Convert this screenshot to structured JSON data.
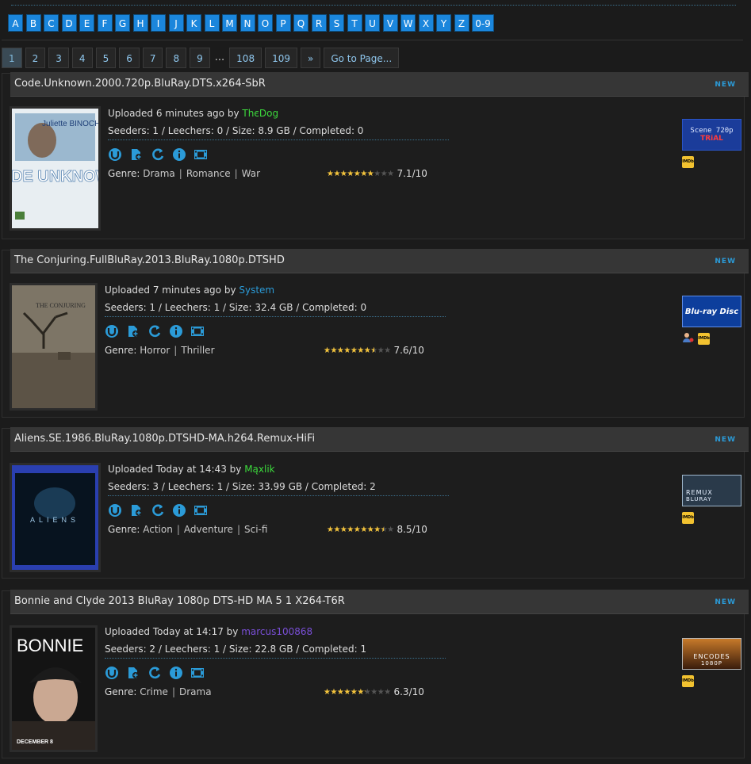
{
  "alphabet": [
    "A",
    "B",
    "C",
    "D",
    "E",
    "F",
    "G",
    "H",
    "I",
    "J",
    "K",
    "L",
    "M",
    "N",
    "O",
    "P",
    "Q",
    "R",
    "S",
    "T",
    "U",
    "V",
    "W",
    "X",
    "Y",
    "Z",
    "0-9"
  ],
  "pager": {
    "pages": [
      "1",
      "2",
      "3",
      "4",
      "5",
      "6",
      "7",
      "8",
      "9"
    ],
    "dots": "...",
    "last_pages": [
      "108",
      "109"
    ],
    "next": "»",
    "goto": "Go to Page..."
  },
  "torrents": [
    {
      "title": "Code.Unknown.2000.720p.BluRay.DTS.x264-SbR",
      "new": "NEW",
      "uploaded_prefix": "Uploaded 6 minutes ago by",
      "uploader": "ThєDog",
      "uploader_color": "#3cd93c",
      "stats": "Seeders: 1 / Leechers: 0 / Size: 8.9 GB / Completed: 0",
      "genre_label": "Genre:",
      "genres": [
        "Drama",
        "Romance",
        "War"
      ],
      "rating_text": "7.1/10",
      "rating": 7.1,
      "poster_text": "CODE UNKNOWN",
      "poster_top": "Juliette BINOCHE",
      "badge_line1": "Scene 720p",
      "badge_line2": "TRiAL",
      "imdb": "IMDb"
    },
    {
      "title": "The Conjuring.FullBluRay.2013.BluRay.1080p.DTSHD",
      "new": "NEW",
      "uploaded_prefix": "Uploaded 7 minutes ago by",
      "uploader": "System",
      "uploader_color": "#2b9bd8",
      "stats": "Seeders: 1 / Leechers: 1 / Size: 32.4 GB / Completed: 0",
      "genre_label": "Genre:",
      "genres": [
        "Horror",
        "Thriller"
      ],
      "rating_text": "7.6/10",
      "rating": 7.6,
      "poster_text": "THE CONJURING",
      "badge_line1": "Blu-ray Disc",
      "imdb": "IMDb"
    },
    {
      "title": "Aliens.SE.1986.BluRay.1080p.DTSHD-MA.h264.Remux-HiFi",
      "new": "NEW",
      "uploaded_prefix": "Uploaded Today at 14:43 by",
      "uploader": "Mąxlik",
      "uploader_color": "#3cd93c",
      "stats": "Seeders: 3 / Leechers: 1 / Size: 33.99 GB / Completed: 2",
      "genre_label": "Genre:",
      "genres": [
        "Action",
        "Adventure",
        "Sci-fi"
      ],
      "rating_text": "8.5/10",
      "rating": 8.5,
      "poster_text": "ALIENS",
      "badge_line1": "REMUX",
      "badge_line2": "BLURAY",
      "imdb": "IMDb"
    },
    {
      "title": "Bonnie and Clyde 2013 BluRay 1080p DTS-HD MA 5 1 X264-T6R",
      "new": "NEW",
      "uploaded_prefix": "Uploaded Today at 14:17 by",
      "uploader": "marcus100868",
      "uploader_color": "#7a4fd8",
      "stats": "Seeders: 2 / Leechers: 1 / Size: 22.8 GB / Completed: 1",
      "genre_label": "Genre:",
      "genres": [
        "Crime",
        "Drama"
      ],
      "rating_text": "6.3/10",
      "rating": 6.3,
      "poster_text": "BONNIE",
      "poster_bottom": "DECEMBER 8",
      "badge_line1": "ENCODES",
      "badge_line2": "1080P",
      "imdb": "IMDb"
    }
  ]
}
